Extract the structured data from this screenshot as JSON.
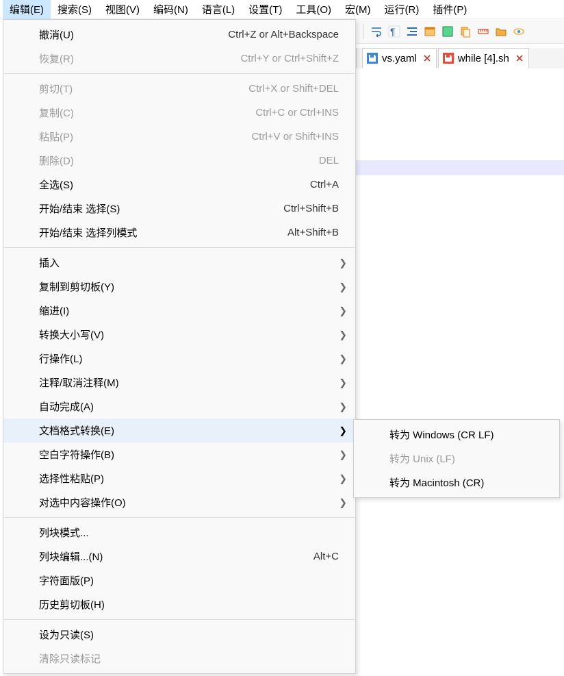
{
  "menubar": {
    "items": [
      {
        "label": "编辑(E)"
      },
      {
        "label": "搜索(S)"
      },
      {
        "label": "视图(V)"
      },
      {
        "label": "编码(N)"
      },
      {
        "label": "语言(L)"
      },
      {
        "label": "设置(T)"
      },
      {
        "label": "工具(O)"
      },
      {
        "label": "宏(M)"
      },
      {
        "label": "运行(R)"
      },
      {
        "label": "插件(P)"
      }
    ]
  },
  "tabs": {
    "items": [
      {
        "label": "vs.yaml",
        "iconcolor": "#2aa3d8",
        "savebg": "#3f87d6"
      },
      {
        "label": "while [4].sh",
        "iconcolor": "#c0392b",
        "savebg": "#e74c3c"
      }
    ]
  },
  "dropdown": {
    "g1": [
      {
        "label": "撤消(U)",
        "shortcut": "Ctrl+Z or Alt+Backspace",
        "disabled": false
      },
      {
        "label": "恢复(R)",
        "shortcut": "Ctrl+Y or Ctrl+Shift+Z",
        "disabled": true
      }
    ],
    "g2": [
      {
        "label": "剪切(T)",
        "shortcut": "Ctrl+X or Shift+DEL",
        "disabled": true
      },
      {
        "label": "复制(C)",
        "shortcut": "Ctrl+C or Ctrl+INS",
        "disabled": true
      },
      {
        "label": "粘贴(P)",
        "shortcut": "Ctrl+V or Shift+INS",
        "disabled": true
      },
      {
        "label": "删除(D)",
        "shortcut": "DEL",
        "disabled": true
      },
      {
        "label": "全选(S)",
        "shortcut": "Ctrl+A",
        "disabled": false
      },
      {
        "label": "开始/结束 选择(S)",
        "shortcut": "Ctrl+Shift+B",
        "disabled": false
      },
      {
        "label": "开始/结束 选择列模式",
        "shortcut": "Alt+Shift+B",
        "disabled": false
      }
    ],
    "g3": [
      {
        "label": "插入"
      },
      {
        "label": "复制到剪切板(Y)"
      },
      {
        "label": "缩进(I)"
      },
      {
        "label": "转换大小写(V)"
      },
      {
        "label": "行操作(L)"
      },
      {
        "label": "注释/取消注释(M)"
      },
      {
        "label": "自动完成(A)"
      },
      {
        "label": "文档格式转换(E)",
        "highlight": true
      },
      {
        "label": "空白字符操作(B)"
      },
      {
        "label": "选择性粘贴(P)"
      },
      {
        "label": "对选中内容操作(O)"
      }
    ],
    "g4": [
      {
        "label": "列块模式..."
      },
      {
        "label": "列块编辑...(N)",
        "shortcut": "Alt+C"
      },
      {
        "label": "字符面版(P)"
      },
      {
        "label": "历史剪切板(H)"
      }
    ],
    "g5": [
      {
        "label": "设为只读(S)",
        "disabled": false
      },
      {
        "label": "清除只读标记",
        "disabled": true
      }
    ]
  },
  "submenu": {
    "items": [
      {
        "label": "转为 Windows (CR LF)",
        "disabled": false
      },
      {
        "label": "转为 Unix (LF)",
        "disabled": true
      },
      {
        "label": "转为 Macintosh (CR)",
        "disabled": false
      }
    ]
  }
}
